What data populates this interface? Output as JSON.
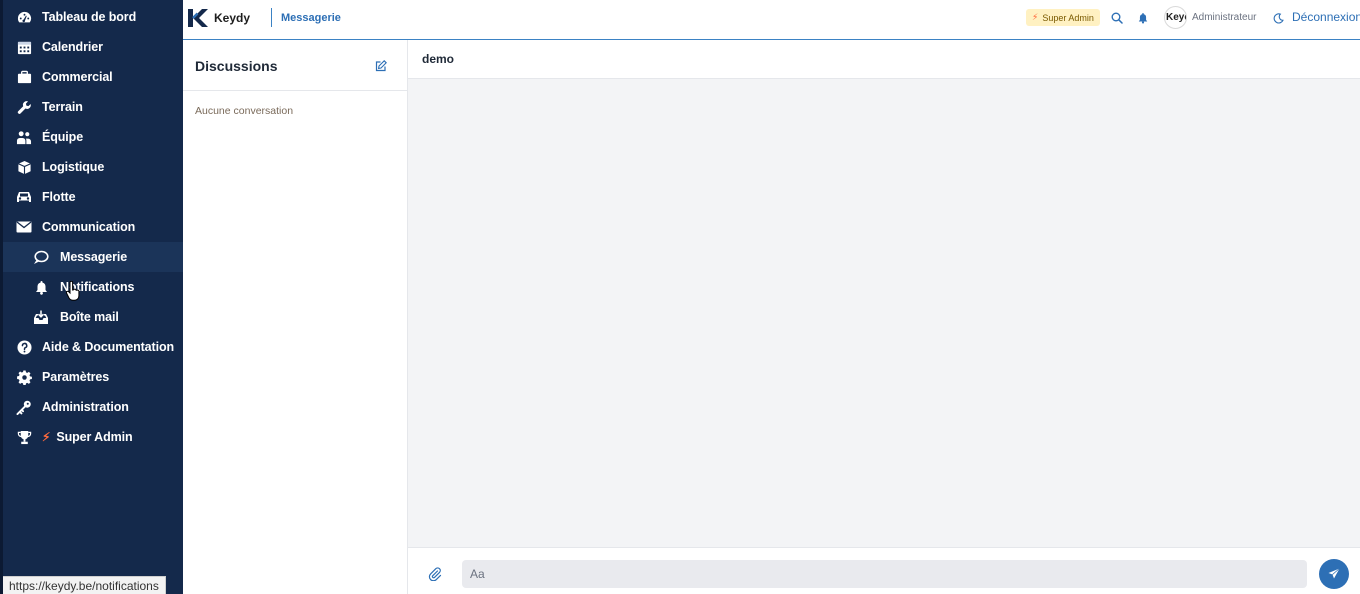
{
  "sidebar": {
    "items": [
      {
        "label": "Tableau de bord",
        "icon": "gauge-icon"
      },
      {
        "label": "Calendrier",
        "icon": "calendar-icon"
      },
      {
        "label": "Commercial",
        "icon": "briefcase-icon"
      },
      {
        "label": "Terrain",
        "icon": "wrench-icon"
      },
      {
        "label": "Équipe",
        "icon": "users-icon"
      },
      {
        "label": "Logistique",
        "icon": "box-icon"
      },
      {
        "label": "Flotte",
        "icon": "car-icon"
      },
      {
        "label": "Communication",
        "icon": "envelope-icon"
      },
      {
        "label": "Messagerie",
        "icon": "chat-icon",
        "active": true
      },
      {
        "label": "Notifications",
        "icon": "bell-icon"
      },
      {
        "label": "Boîte mail",
        "icon": "inbox-icon"
      },
      {
        "label": "Aide & Documentation",
        "icon": "help-icon"
      },
      {
        "label": "Paramètres",
        "icon": "gear-icon"
      },
      {
        "label": "Administration",
        "icon": "key-icon"
      },
      {
        "label": "Super Admin",
        "icon": "trophy-icon"
      }
    ]
  },
  "header": {
    "brand": "Keydy",
    "breadcrumb": "Messagerie",
    "badge": "Super Admin",
    "avatar_text": "Keydy",
    "role": "Administrateur",
    "logout": "Déconnexion"
  },
  "discussions": {
    "title": "Discussions",
    "empty_text": "Aucune conversation"
  },
  "chat": {
    "contact": "demo",
    "input_placeholder": "Aa"
  },
  "status_bar": {
    "url": "https://keydy.be/notifications"
  },
  "colors": {
    "sidebar_bg": "#14294b",
    "accent": "#2d6fb5",
    "super_admin_bolt": "#ff6a3d"
  }
}
